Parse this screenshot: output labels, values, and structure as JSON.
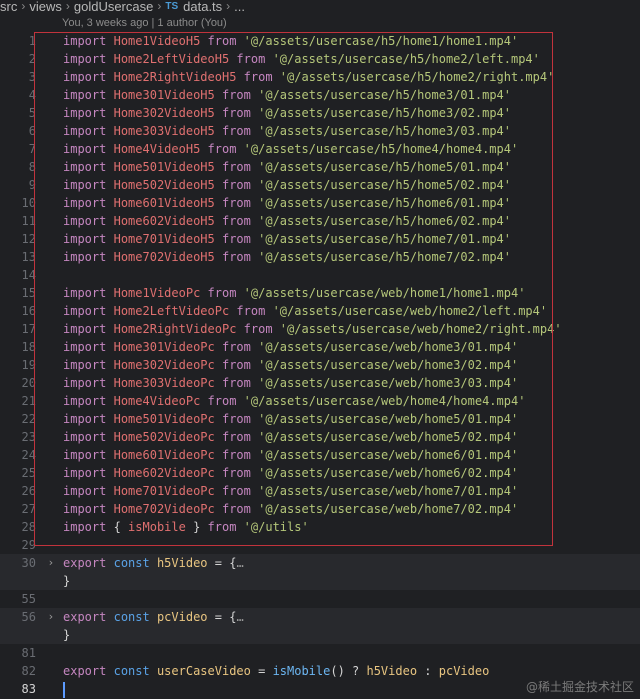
{
  "breadcrumb": {
    "items": [
      "src",
      "views",
      "goldUsercase"
    ],
    "file_badge": "TS",
    "file_name": "data.ts",
    "trailing": "..."
  },
  "blame": "You, 3 weeks ago | 1 author (You)",
  "watermark": "@稀土掘金技术社区",
  "colors": {
    "background": "#1f2023",
    "keyword": "#c586c0",
    "identifier": "#e07070",
    "string": "#b5c77a",
    "selection_box": "#c1333c"
  },
  "lines": [
    {
      "n": "1",
      "kind": "import",
      "name": "Home1VideoH5",
      "path": "'@/assets/usercase/h5/home1/home1.mp4'"
    },
    {
      "n": "2",
      "kind": "import",
      "name": "Home2LeftVideoH5",
      "path": "'@/assets/usercase/h5/home2/left.mp4'"
    },
    {
      "n": "3",
      "kind": "import",
      "name": "Home2RightVideoH5",
      "path": "'@/assets/usercase/h5/home2/right.mp4'"
    },
    {
      "n": "4",
      "kind": "import",
      "name": "Home301VideoH5",
      "path": "'@/assets/usercase/h5/home3/01.mp4'"
    },
    {
      "n": "5",
      "kind": "import",
      "name": "Home302VideoH5",
      "path": "'@/assets/usercase/h5/home3/02.mp4'"
    },
    {
      "n": "6",
      "kind": "import",
      "name": "Home303VideoH5",
      "path": "'@/assets/usercase/h5/home3/03.mp4'"
    },
    {
      "n": "7",
      "kind": "import",
      "name": "Home4VideoH5",
      "path": "'@/assets/usercase/h5/home4/home4.mp4'"
    },
    {
      "n": "8",
      "kind": "import",
      "name": "Home501VideoH5",
      "path": "'@/assets/usercase/h5/home5/01.mp4'"
    },
    {
      "n": "9",
      "kind": "import",
      "name": "Home502VideoH5",
      "path": "'@/assets/usercase/h5/home5/02.mp4'"
    },
    {
      "n": "10",
      "kind": "import",
      "name": "Home601VideoH5",
      "path": "'@/assets/usercase/h5/home6/01.mp4'"
    },
    {
      "n": "11",
      "kind": "import",
      "name": "Home602VideoH5",
      "path": "'@/assets/usercase/h5/home6/02.mp4'"
    },
    {
      "n": "12",
      "kind": "import",
      "name": "Home701VideoH5",
      "path": "'@/assets/usercase/h5/home7/01.mp4'"
    },
    {
      "n": "13",
      "kind": "import",
      "name": "Home702VideoH5",
      "path": "'@/assets/usercase/h5/home7/02.mp4'"
    },
    {
      "n": "14",
      "kind": "blank"
    },
    {
      "n": "15",
      "kind": "import",
      "name": "Home1VideoPc",
      "path": "'@/assets/usercase/web/home1/home1.mp4'"
    },
    {
      "n": "16",
      "kind": "import",
      "name": "Home2LeftVideoPc",
      "path": "'@/assets/usercase/web/home2/left.mp4'"
    },
    {
      "n": "17",
      "kind": "import",
      "name": "Home2RightVideoPc",
      "path": "'@/assets/usercase/web/home2/right.mp4'"
    },
    {
      "n": "18",
      "kind": "import",
      "name": "Home301VideoPc",
      "path": "'@/assets/usercase/web/home3/01.mp4'"
    },
    {
      "n": "19",
      "kind": "import",
      "name": "Home302VideoPc",
      "path": "'@/assets/usercase/web/home3/02.mp4'"
    },
    {
      "n": "20",
      "kind": "import",
      "name": "Home303VideoPc",
      "path": "'@/assets/usercase/web/home3/03.mp4'"
    },
    {
      "n": "21",
      "kind": "import",
      "name": "Home4VideoPc",
      "path": "'@/assets/usercase/web/home4/home4.mp4'"
    },
    {
      "n": "22",
      "kind": "import",
      "name": "Home501VideoPc",
      "path": "'@/assets/usercase/web/home5/01.mp4'"
    },
    {
      "n": "23",
      "kind": "import",
      "name": "Home502VideoPc",
      "path": "'@/assets/usercase/web/home5/02.mp4'"
    },
    {
      "n": "24",
      "kind": "import",
      "name": "Home601VideoPc",
      "path": "'@/assets/usercase/web/home6/01.mp4'"
    },
    {
      "n": "25",
      "kind": "import",
      "name": "Home602VideoPc",
      "path": "'@/assets/usercase/web/home6/02.mp4'"
    },
    {
      "n": "26",
      "kind": "import",
      "name": "Home701VideoPc",
      "path": "'@/assets/usercase/web/home7/01.mp4'"
    },
    {
      "n": "27",
      "kind": "import",
      "name": "Home702VideoPc",
      "path": "'@/assets/usercase/web/home7/02.mp4'"
    },
    {
      "n": "28",
      "kind": "import_named",
      "name": "isMobile",
      "path": "'@/utils'"
    },
    {
      "n": "29",
      "kind": "blank"
    },
    {
      "n": "30",
      "kind": "export_fold",
      "name": "h5Video",
      "shaded": true
    },
    {
      "n": "",
      "kind": "close",
      "shaded": true
    },
    {
      "n": "55",
      "kind": "blank"
    },
    {
      "n": "56",
      "kind": "export_fold",
      "name": "pcVideo",
      "shaded": true
    },
    {
      "n": "",
      "kind": "close",
      "shaded": true
    },
    {
      "n": "81",
      "kind": "blank"
    },
    {
      "n": "82",
      "kind": "export_ternary",
      "name": "userCaseVideo",
      "fn": "isMobile",
      "a": "h5Video",
      "b": "pcVideo"
    },
    {
      "n": "83",
      "kind": "cursor",
      "current": true
    }
  ]
}
